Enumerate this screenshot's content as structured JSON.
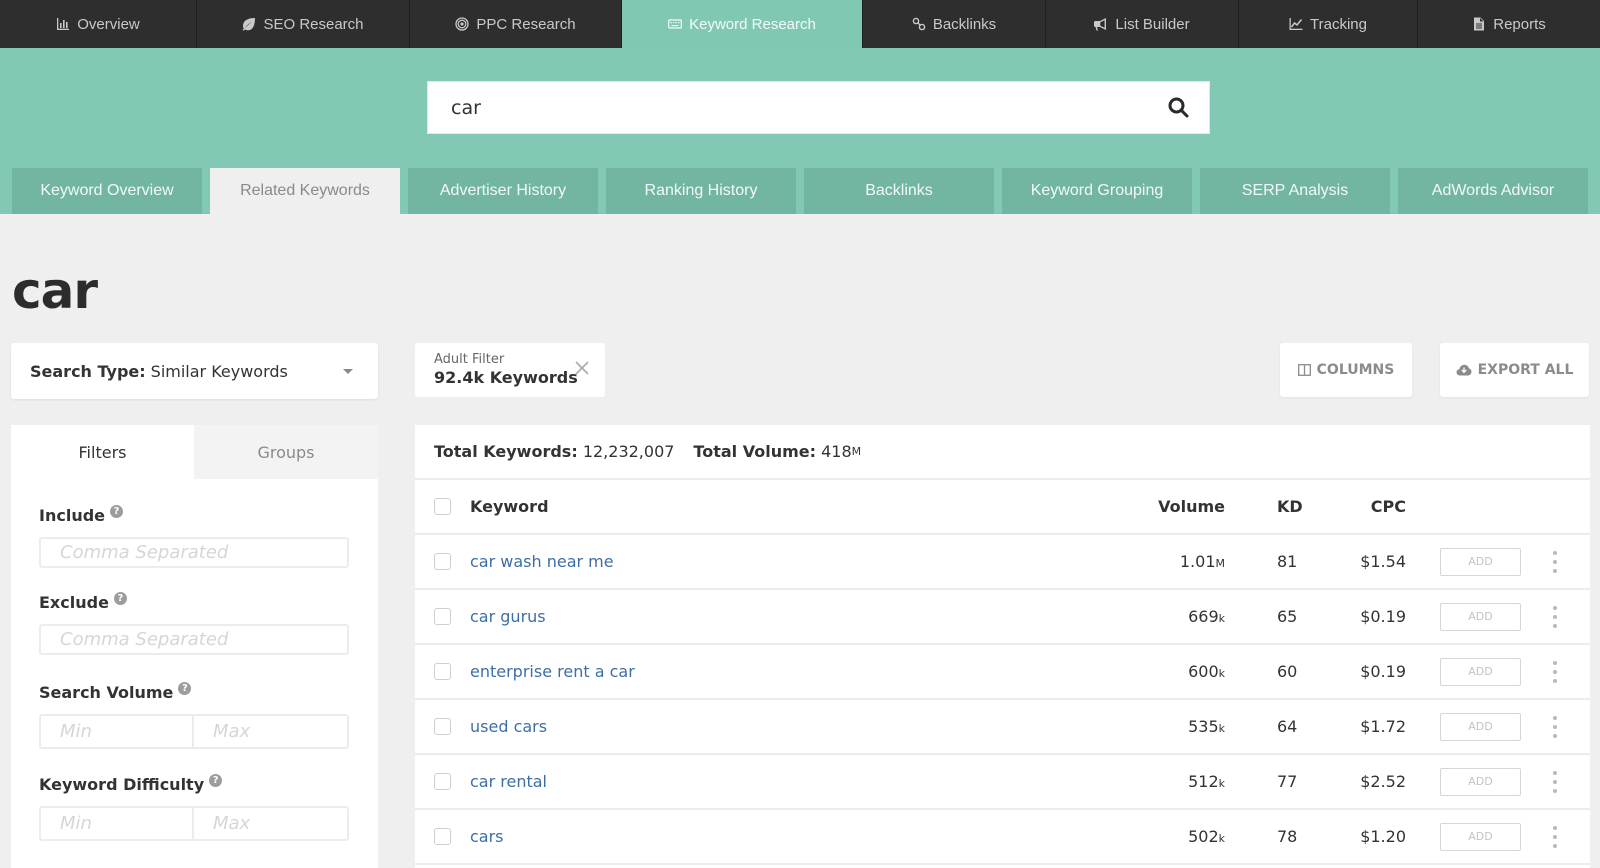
{
  "topnav": {
    "items": [
      {
        "label": "Overview",
        "icon": "bar-chart-icon",
        "active": false
      },
      {
        "label": "SEO Research",
        "icon": "leaf-icon",
        "active": false
      },
      {
        "label": "PPC Research",
        "icon": "target-icon",
        "active": false
      },
      {
        "label": "Keyword Research",
        "icon": "keyboard-icon",
        "active": true
      },
      {
        "label": "Backlinks",
        "icon": "link-icon",
        "active": false
      },
      {
        "label": "List Builder",
        "icon": "megaphone-icon",
        "active": false
      },
      {
        "label": "Tracking",
        "icon": "line-chart-icon",
        "active": false
      },
      {
        "label": "Reports",
        "icon": "document-icon",
        "active": false
      }
    ]
  },
  "search": {
    "value": "car",
    "icon": "search-icon"
  },
  "subtabs": [
    {
      "label": "Keyword Overview",
      "active": false
    },
    {
      "label": "Related Keywords",
      "active": true
    },
    {
      "label": "Advertiser History",
      "active": false
    },
    {
      "label": "Ranking History",
      "active": false
    },
    {
      "label": "Backlinks",
      "active": false
    },
    {
      "label": "Keyword Grouping",
      "active": false
    },
    {
      "label": "SERP Analysis",
      "active": false
    },
    {
      "label": "AdWords Advisor",
      "active": false
    }
  ],
  "page_title": "car",
  "search_type": {
    "label": "Search Type:",
    "value": "Similar Keywords"
  },
  "adult_filter": {
    "title": "Adult Filter",
    "count": "92.4k Keywords"
  },
  "toolbar": {
    "columns_label": "COLUMNS",
    "export_label": "EXPORT ALL"
  },
  "filters_panel": {
    "tabs": [
      {
        "label": "Filters",
        "active": true
      },
      {
        "label": "Groups",
        "active": false
      }
    ],
    "include": {
      "label": "Include",
      "placeholder": "Comma Separated"
    },
    "exclude": {
      "label": "Exclude",
      "placeholder": "Comma Separated"
    },
    "search_volume": {
      "label": "Search Volume",
      "min_placeholder": "Min",
      "max_placeholder": "Max"
    },
    "keyword_difficulty": {
      "label": "Keyword Difficulty",
      "min_placeholder": "Min",
      "max_placeholder": "Max"
    },
    "help_glyph": "?"
  },
  "results": {
    "total_keywords_label": "Total Keywords:",
    "total_keywords": "12,232,007",
    "total_volume_label": "Total Volume:",
    "total_volume": "418",
    "total_volume_unit": "M",
    "columns": {
      "keyword": "Keyword",
      "volume": "Volume",
      "kd": "KD",
      "cpc": "CPC"
    },
    "add_label": "ADD",
    "rows": [
      {
        "keyword": "car wash near me",
        "volume": "1.01",
        "unit": "M",
        "kd": "81",
        "cpc": "$1.54"
      },
      {
        "keyword": "car gurus",
        "volume": "669",
        "unit": "k",
        "kd": "65",
        "cpc": "$0.19"
      },
      {
        "keyword": "enterprise rent a car",
        "volume": "600",
        "unit": "k",
        "kd": "60",
        "cpc": "$0.19"
      },
      {
        "keyword": "used cars",
        "volume": "535",
        "unit": "k",
        "kd": "64",
        "cpc": "$1.72"
      },
      {
        "keyword": "car rental",
        "volume": "512",
        "unit": "k",
        "kd": "77",
        "cpc": "$2.52"
      },
      {
        "keyword": "cars",
        "volume": "502",
        "unit": "k",
        "kd": "78",
        "cpc": "$1.20"
      }
    ]
  },
  "colors": {
    "accent": "#82c9b5",
    "subtab": "#72b5a2",
    "nav_bg": "#2e2e2e",
    "link": "#3d6ea8"
  }
}
